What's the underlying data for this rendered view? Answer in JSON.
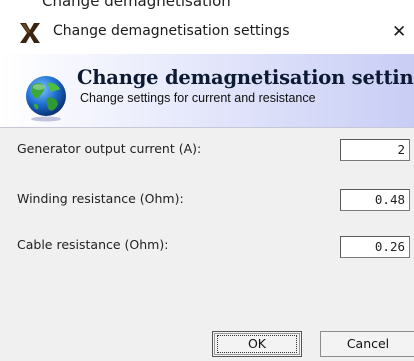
{
  "window": {
    "title": "Change demagnetisation settings",
    "clipped_top_text": "Change demagnetisation"
  },
  "header": {
    "title": "Change demagnetisation settings",
    "subtitle": "Change settings for current and resistance"
  },
  "fields": [
    {
      "label": "Generator output current (A):",
      "value": "2"
    },
    {
      "label": "Winding resistance (Ohm):",
      "value": "0.48"
    },
    {
      "label": "Cable resistance (Ohm):",
      "value": "0.26"
    }
  ],
  "buttons": {
    "ok": "OK",
    "cancel": "Cancel",
    "close": "✕"
  },
  "icons": {
    "app": "x-app-icon",
    "header": "globe-icon",
    "close": "close-icon"
  },
  "colors": {
    "header_gradient_end": "#c9cdf5",
    "dialog_bg": "#f0f0f0"
  }
}
